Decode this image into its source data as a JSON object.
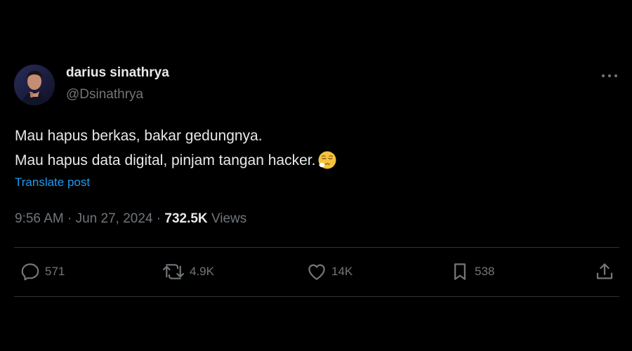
{
  "author": {
    "display_name": "darius sinathrya",
    "handle": "@Dsinathrya",
    "avatar": "avatar-portrait"
  },
  "tweet": {
    "lines": [
      "Mau hapus berkas, bakar gedungnya.",
      "Mau hapus data digital, pinjam tangan hacker."
    ],
    "emoji": "pensive-face-emoji",
    "translate_label": "Translate post"
  },
  "meta": {
    "time": "9:56 AM",
    "separator": "·",
    "date": "Jun 27, 2024",
    "views_count": "732.5K",
    "views_label": "Views"
  },
  "actions": {
    "replies": "571",
    "reposts": "4.9K",
    "likes": "14K",
    "bookmarks": "538"
  },
  "icons": {
    "more": "more-dots-icon",
    "reply": "reply-icon",
    "repost": "repost-icon",
    "like": "heart-icon",
    "bookmark": "bookmark-icon",
    "share": "share-icon"
  },
  "colors": {
    "background": "#000000",
    "text": "#e7e9ea",
    "secondary": "#71767b",
    "link": "#1d9bf0",
    "divider": "#2f3336"
  }
}
